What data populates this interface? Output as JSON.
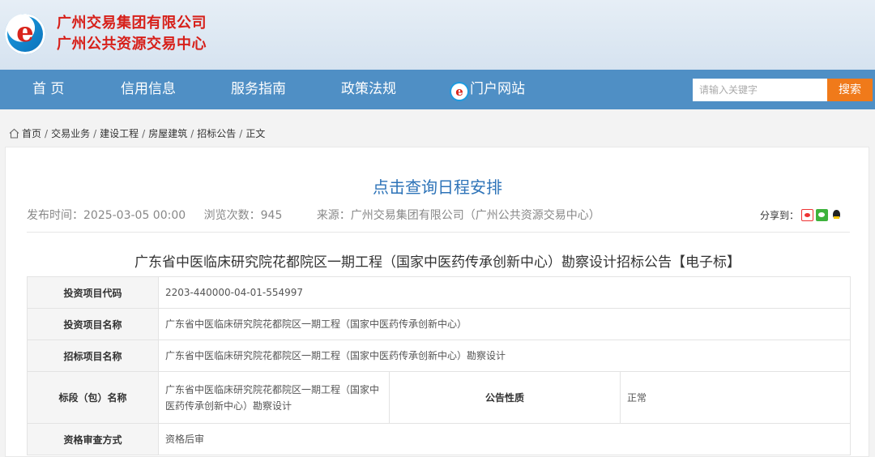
{
  "header": {
    "org_line1": "广州交易集团有限公司",
    "org_line2": "广州公共资源交易中心",
    "logo_glyph": "e"
  },
  "nav": {
    "items": [
      "首 页",
      "信用信息",
      "服务指南",
      "政策法规",
      "门户网站"
    ],
    "portal_glyph": "e",
    "search_placeholder": "请输入关键字",
    "search_label": "搜索"
  },
  "breadcrumb": {
    "items": [
      "首页",
      "交易业务",
      "建设工程",
      "房屋建筑",
      "招标公告",
      "正文"
    ],
    "separator": "/"
  },
  "article": {
    "schedule_link": "点击查询日程安排",
    "publish_time": "发布时间：2025-03-05 00:00",
    "views": "浏览次数：945",
    "source": "来源：广州交易集团有限公司（广州公共资源交易中心）",
    "share_label": "分享到：",
    "title": "广东省中医临床研究院花都院区一期工程（国家中医药传承创新中心）勘察设计招标公告【电子标】"
  },
  "table": {
    "rows": [
      {
        "label": "投资项目代码",
        "value": "2203-440000-04-01-554997"
      },
      {
        "label": "投资项目名称",
        "value": "广东省中医临床研究院花都院区一期工程（国家中医药传承创新中心）"
      },
      {
        "label": "招标项目名称",
        "value": "广东省中医临床研究院花都院区一期工程（国家中医药传承创新中心）勘察设计"
      },
      {
        "label": "标段（包）名称",
        "value": "广东省中医临床研究院花都院区一期工程（国家中医药传承创新中心）勘察设计",
        "label2": "公告性质",
        "value2": "正常"
      },
      {
        "label": "资格审查方式",
        "value": "资格后审"
      }
    ]
  },
  "colors": {
    "nav_bg": "#4f8fc5",
    "brand_red": "#d7201a",
    "link_blue": "#2d73b8",
    "search_orange": "#f07a1a"
  }
}
